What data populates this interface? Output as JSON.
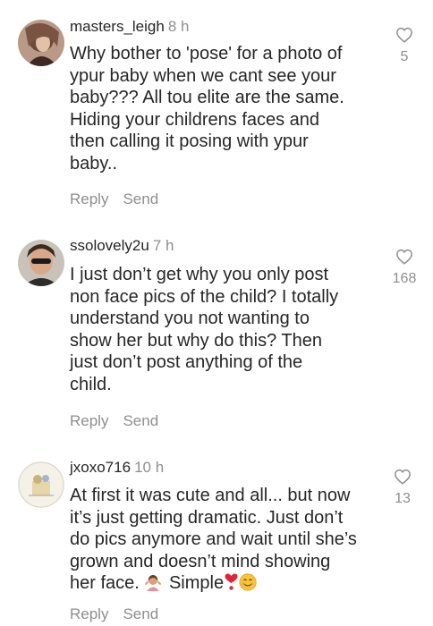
{
  "comments": [
    {
      "username": "masters_leigh",
      "time": "8 h",
      "lines": [
        "Why bother to 'pose'  for a photo of",
        "ypur baby when we cant see your",
        "baby??? All tou elite are the same.",
        "Hiding your childrens faces and",
        "then calling it posing with ypur",
        "baby.."
      ],
      "likes": "5",
      "reply_label": "Reply",
      "send_label": "Send",
      "avatar_icon": "profile-photo"
    },
    {
      "username": "ssolovely2u",
      "time": "7 h",
      "lines": [
        "I just don’t get why you only post",
        "non face pics of the child? I totally",
        "understand you not wanting to",
        "show her but why do this? Then",
        "just don’t post anything of the",
        "child."
      ],
      "likes": "168",
      "reply_label": "Reply",
      "send_label": "Send",
      "avatar_icon": "profile-photo"
    },
    {
      "username": "jxoxo716",
      "time": "10 h",
      "lines": [
        "At first it was cute and all... but now",
        "it’s just getting dramatic. Just don’t",
        "do pics anymore and wait until she’s",
        "grown and doesn’t mind showing"
      ],
      "last_line_text": "her face.",
      "last_line_simple": "Simple",
      "last_line_emojis": [
        "woman-shrugging",
        "red-exclamation-heart",
        "smiling-face"
      ],
      "likes": "13",
      "reply_label": "Reply",
      "send_label": "Send",
      "avatar_icon": "profile-photo"
    }
  ],
  "colors": {
    "text": "#262626",
    "secondary": "#8e8e8e",
    "background": "#ffffff"
  },
  "like_icon": "heart-outline-icon"
}
